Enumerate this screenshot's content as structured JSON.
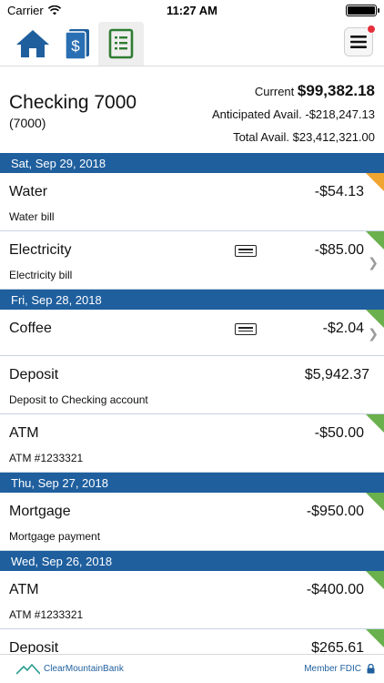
{
  "status_bar": {
    "carrier": "Carrier",
    "time": "11:27 AM"
  },
  "nav": {
    "tabs": [
      {
        "icon": "home-icon"
      },
      {
        "icon": "dollar-document-icon"
      },
      {
        "icon": "ledger-icon",
        "active": true
      }
    ],
    "menu_icon": "hamburger-menu-icon",
    "accent": "#1f5f9e"
  },
  "account": {
    "name": "Checking 7000",
    "number": "(7000)",
    "current_label": "Current",
    "current_value": "$99,382.18",
    "anticipated_label": "Anticipated Avail.",
    "anticipated_value": "-$218,247.13",
    "total_label": "Total Avail.",
    "total_value": "$23,412,321.00"
  },
  "groups": [
    {
      "date": "Sat, Sep 29, 2018",
      "transactions": [
        {
          "title": "Water",
          "desc": "Water bill",
          "amount": "-$54.13",
          "status": "pending"
        },
        {
          "title": "Electricity",
          "desc": "Electricity bill",
          "amount": "-$85.00",
          "status": "cleared",
          "card": true,
          "chevron": true
        }
      ]
    },
    {
      "date": "Fri, Sep 28, 2018",
      "transactions": [
        {
          "title": "Coffee",
          "desc": "",
          "amount": "-$2.04",
          "status": "cleared",
          "card": true,
          "chevron": true
        },
        {
          "title": "Deposit",
          "desc": "Deposit to Checking account",
          "amount": "$5,942.37",
          "status": "cleared"
        },
        {
          "title": "ATM",
          "desc": "ATM #1233321",
          "amount": "-$50.00",
          "status": "cleared"
        }
      ]
    },
    {
      "date": "Thu, Sep 27, 2018",
      "transactions": [
        {
          "title": "Mortgage",
          "desc": "Mortgage payment",
          "amount": "-$950.00",
          "status": "cleared"
        }
      ]
    },
    {
      "date": "Wed, Sep 26, 2018",
      "transactions": [
        {
          "title": "ATM",
          "desc": "ATM #1233321",
          "amount": "-$400.00",
          "status": "cleared"
        },
        {
          "title": "Deposit",
          "desc": "",
          "amount": "$265.61",
          "status": "cleared"
        }
      ]
    }
  ],
  "footer": {
    "bank_name": "ClearMountainBank",
    "fdic": "Member FDIC"
  }
}
